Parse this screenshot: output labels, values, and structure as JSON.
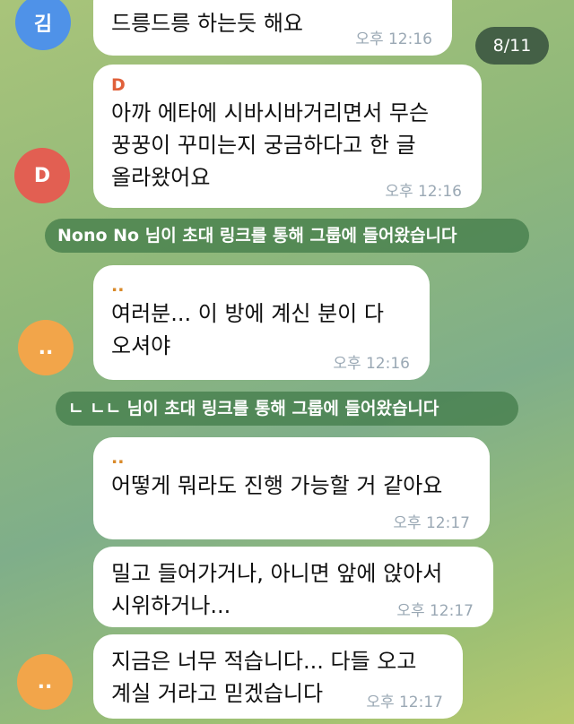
{
  "counter": "8/11",
  "avatars": {
    "kim": "김",
    "d": "D",
    "dots1": "..",
    "dots2": ".."
  },
  "messages": [
    {
      "text": "드릉드릉 하는듯 해요",
      "time": "오후 12:16"
    },
    {
      "sender": "D",
      "text": "아까 에타에 시바시바거리면서 무슨\n꿍꿍이 꾸미는지 궁금하다고 한 글\n올라왔어요",
      "time": "오후 12:16"
    },
    {
      "sender": "..",
      "text": "여러분... 이 방에 계신 분이 다\n오셔야",
      "time": "오후 12:16"
    },
    {
      "sender": "..",
      "text": "어떻게 뭐라도 진행 가능할 거 같아요",
      "time": "오후 12:17"
    },
    {
      "text": "밀고 들어가거나, 아니면 앞에 앉아서\n시위하거나...",
      "time": "오후 12:17"
    },
    {
      "text": "지금은 너무 적습니다... 다들 오고\n계실 거라고 믿겠습니다",
      "time": "오후 12:17"
    }
  ],
  "service_messages": [
    "Nono No 님이 초대 링크를 통해 그룹에 들어왔습니다",
    "ㄴ ㄴㄴ 님이 초대 링크를 통해 그룹에 들어왔습니다"
  ],
  "colors": {
    "sender_d": "#e0603a",
    "sender_dots": "#d98a2a",
    "service_bg": "#3e7846"
  }
}
